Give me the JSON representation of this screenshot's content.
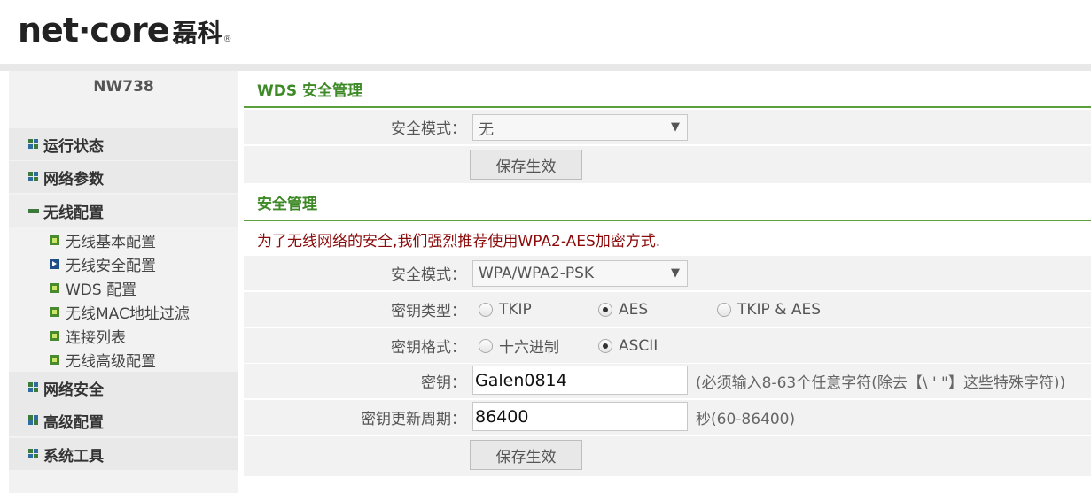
{
  "brand": {
    "logo_en": "net·core",
    "logo_zh": "磊科",
    "registered_mark": "®"
  },
  "sidebar": {
    "model": "NW738",
    "menu": [
      {
        "label": "运行状态",
        "icon": "grid-icon"
      },
      {
        "label": "网络参数",
        "icon": "grid-icon"
      },
      {
        "label": "无线配置",
        "icon": "minus-icon",
        "expanded": true
      },
      {
        "label": "网络安全",
        "icon": "grid-icon"
      },
      {
        "label": "高级配置",
        "icon": "grid-icon"
      },
      {
        "label": "系统工具",
        "icon": "grid-icon"
      }
    ],
    "wireless_sub": [
      {
        "label": "无线基本配置"
      },
      {
        "label": "无线安全配置",
        "active": true
      },
      {
        "label": "WDS 配置"
      },
      {
        "label": "无线MAC地址过滤"
      },
      {
        "label": "连接列表"
      },
      {
        "label": "无线高级配置"
      }
    ]
  },
  "wds": {
    "title": "WDS 安全管理",
    "mode_label": "安全模式：",
    "mode_value": "无",
    "save_label": "保存生效"
  },
  "security": {
    "title": "安全管理",
    "notice": "为了无线网络的安全,我们强烈推荐使用WPA2-AES加密方式.",
    "mode_label": "安全模式：",
    "mode_value": "WPA/WPA2-PSK",
    "key_type_label": "密钥类型：",
    "key_type_options": [
      "TKIP",
      "AES",
      "TKIP & AES"
    ],
    "key_type_selected": "AES",
    "key_format_label": "密钥格式：",
    "key_format_options": [
      "十六进制",
      "ASCII"
    ],
    "key_format_selected": "ASCII",
    "key_label": "密钥：",
    "key_value": "Galen0814",
    "key_hint": "(必须输入8-63个任意字符(除去【\\ ' \"】这些特殊字符))",
    "period_label": "密钥更新周期：",
    "period_value": "86400",
    "period_hint": "秒(60-86400)",
    "save_label": "保存生效"
  },
  "colors": {
    "accent_green": "#3f8a28",
    "notice_red": "#8b0a0a",
    "row_bg": "#f2f2f2"
  }
}
